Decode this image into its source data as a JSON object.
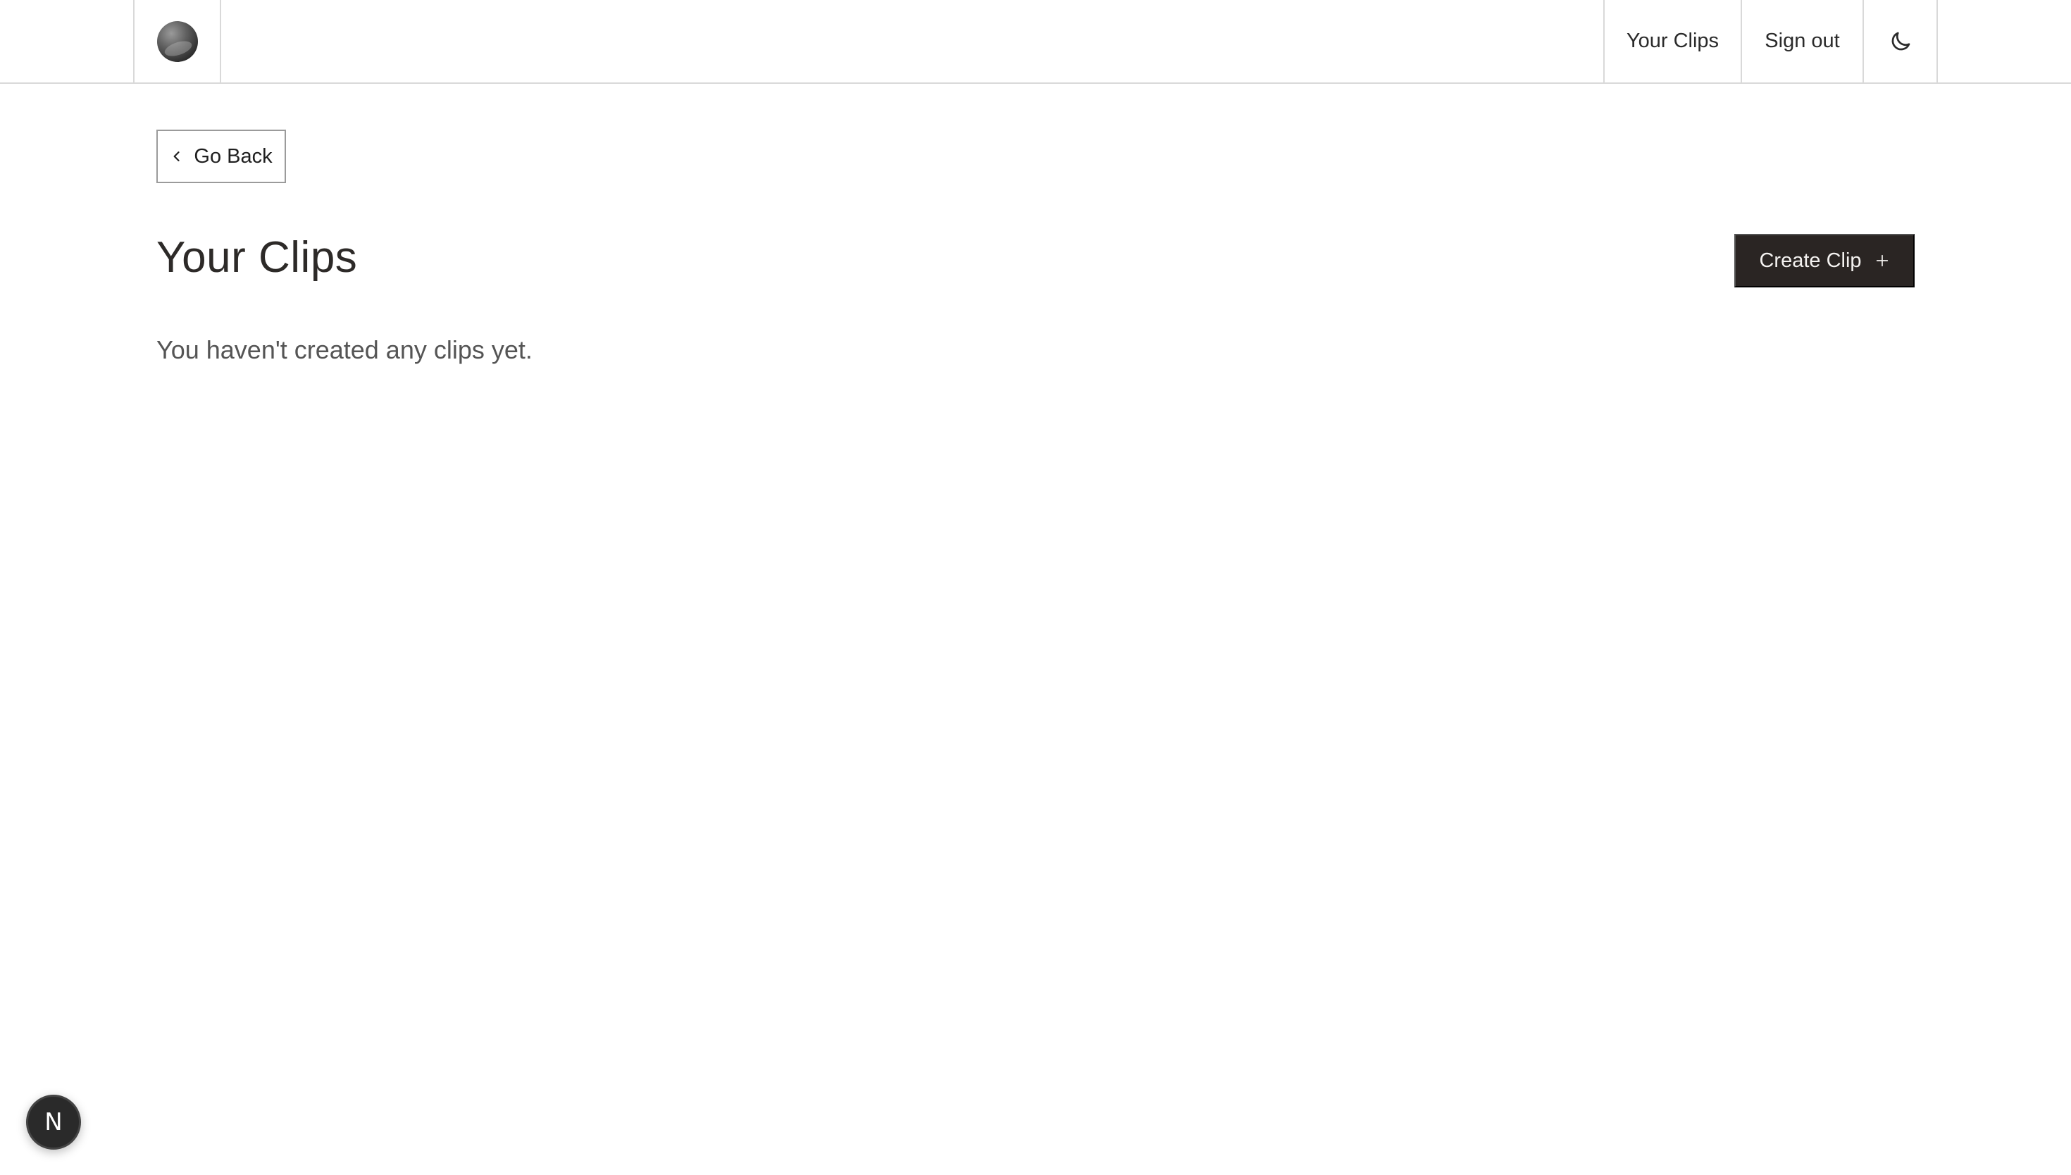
{
  "header": {
    "avatar_icon": "avatar-icon",
    "nav": {
      "your_clips": "Your Clips",
      "sign_out": "Sign out",
      "theme_icon": "moon-icon"
    }
  },
  "main": {
    "go_back_label": "Go Back",
    "go_back_icon": "chevron-left-icon",
    "title": "Your Clips",
    "create_label": "Create Clip",
    "create_icon": "plus-icon",
    "empty_message": "You haven't created any clips yet."
  },
  "dev_badge": {
    "label": "N"
  },
  "colors": {
    "primary_button": "#2a2523",
    "border": "#d9d9d9"
  }
}
